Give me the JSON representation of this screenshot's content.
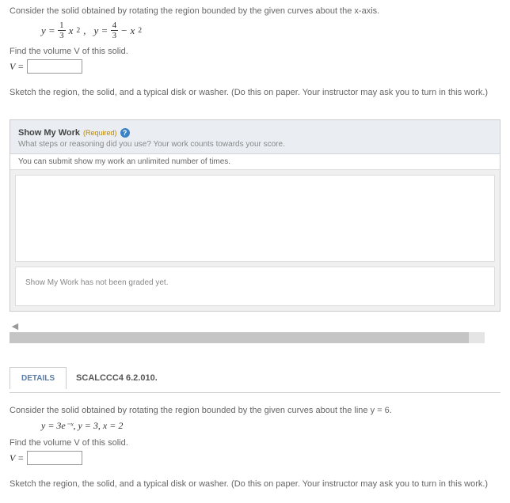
{
  "problem1": {
    "prompt": "Consider the solid obtained by rotating the region bounded by the given curves about the x-axis.",
    "findVolume": "Find the volume V of this solid.",
    "vLabel": "V =",
    "sketch": "Sketch the region, the solid, and a typical disk or washer. (Do this on paper. Your instructor may ask you to turn in this work.)"
  },
  "workPanel": {
    "title": "Show My Work",
    "required": "(Required)",
    "subtitle": "What steps or reasoning did you use? Your work counts towards your score.",
    "note": "You can submit show my work an unlimited number of times.",
    "status": "Show My Work has not been graded yet."
  },
  "section2": {
    "details": "DETAILS",
    "code": "SCALCCC4 6.2.010."
  },
  "problem2": {
    "prompt": "Consider the solid obtained by rotating the region bounded by the given curves about the line y = 6.",
    "equations": "y = 3e⁻ˣ, y = 3, x = 2",
    "findVolume": "Find the volume V of this solid.",
    "vLabel": "V =",
    "sketch": "Sketch the region, the solid, and a typical disk or washer. (Do this on paper. Your instructor may ask you to turn in this work.)"
  }
}
